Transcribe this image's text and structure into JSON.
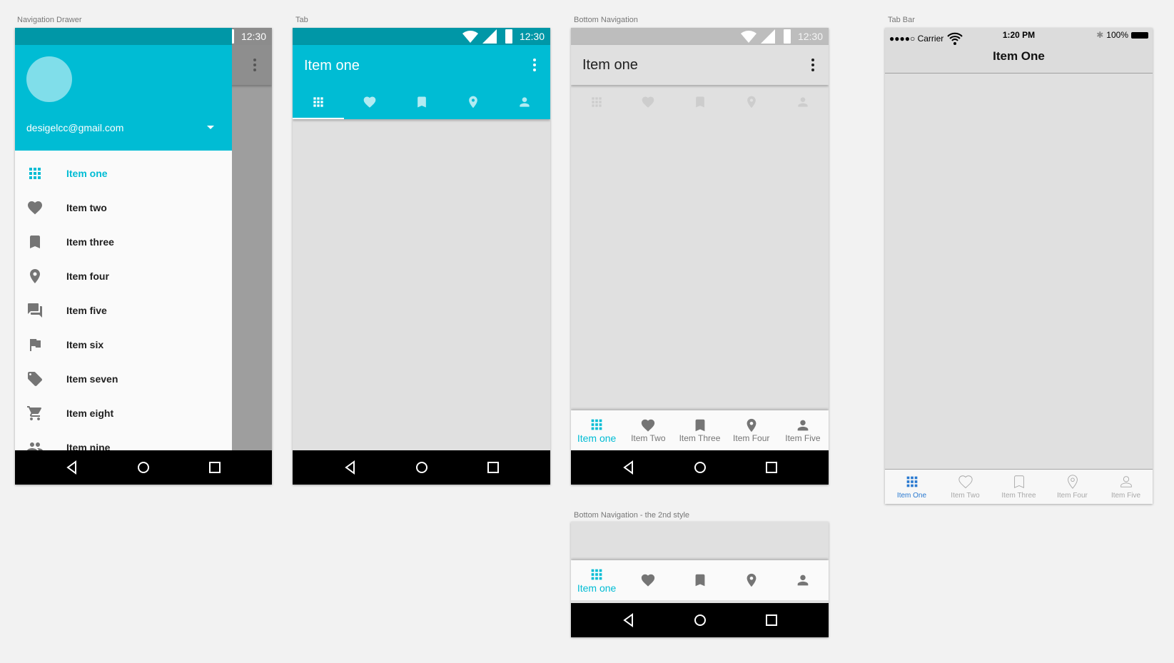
{
  "captions": {
    "drawer": "Navigation Drawer",
    "tab": "Tab",
    "bottom": "Bottom Navigation",
    "bottom2": "Bottom Navigation - the 2nd style",
    "tabbar": "Tab Bar"
  },
  "android_status_time": "12:30",
  "colors": {
    "primary": "#00bcd4",
    "primary_dark": "#0097a7",
    "ios_active": "#2979d0",
    "inactive": "#757575"
  },
  "drawer": {
    "email": "desigelcc@gmail.com",
    "items": [
      {
        "label": "Item one",
        "icon": "grid",
        "active": true
      },
      {
        "label": "Item two",
        "icon": "heart"
      },
      {
        "label": "Item three",
        "icon": "bookmark"
      },
      {
        "label": "Item four",
        "icon": "place"
      },
      {
        "label": "Item five",
        "icon": "forum"
      },
      {
        "label": "Item six",
        "icon": "flag"
      },
      {
        "label": "Item seven",
        "icon": "tag"
      },
      {
        "label": "Item eight",
        "icon": "cart"
      },
      {
        "label": "Item nine",
        "icon": "people"
      }
    ]
  },
  "tab": {
    "title": "Item one",
    "icons": [
      "grid",
      "heart",
      "bookmark",
      "place",
      "person"
    ]
  },
  "bottom_nav": {
    "title": "Item one",
    "items": [
      {
        "label": "Item one",
        "icon": "grid",
        "active": true
      },
      {
        "label": "Item Two",
        "icon": "heart"
      },
      {
        "label": "Item Three",
        "icon": "bookmark"
      },
      {
        "label": "Item Four",
        "icon": "place"
      },
      {
        "label": "Item Five",
        "icon": "person"
      }
    ]
  },
  "bottom_nav2": {
    "items": [
      {
        "label": "Item one",
        "icon": "grid",
        "active": true
      },
      {
        "icon": "heart"
      },
      {
        "icon": "bookmark"
      },
      {
        "icon": "place"
      },
      {
        "icon": "person"
      }
    ]
  },
  "ios": {
    "carrier": "●●●●○ Carrier",
    "time": "1:20 PM",
    "battery": "100%",
    "title": "Item One",
    "items": [
      {
        "label": "Item One",
        "icon": "grid",
        "active": true
      },
      {
        "label": "Item Two",
        "icon": "heart"
      },
      {
        "label": "Item Three",
        "icon": "bookmark"
      },
      {
        "label": "Item Four",
        "icon": "place"
      },
      {
        "label": "Item Five",
        "icon": "person"
      }
    ]
  }
}
